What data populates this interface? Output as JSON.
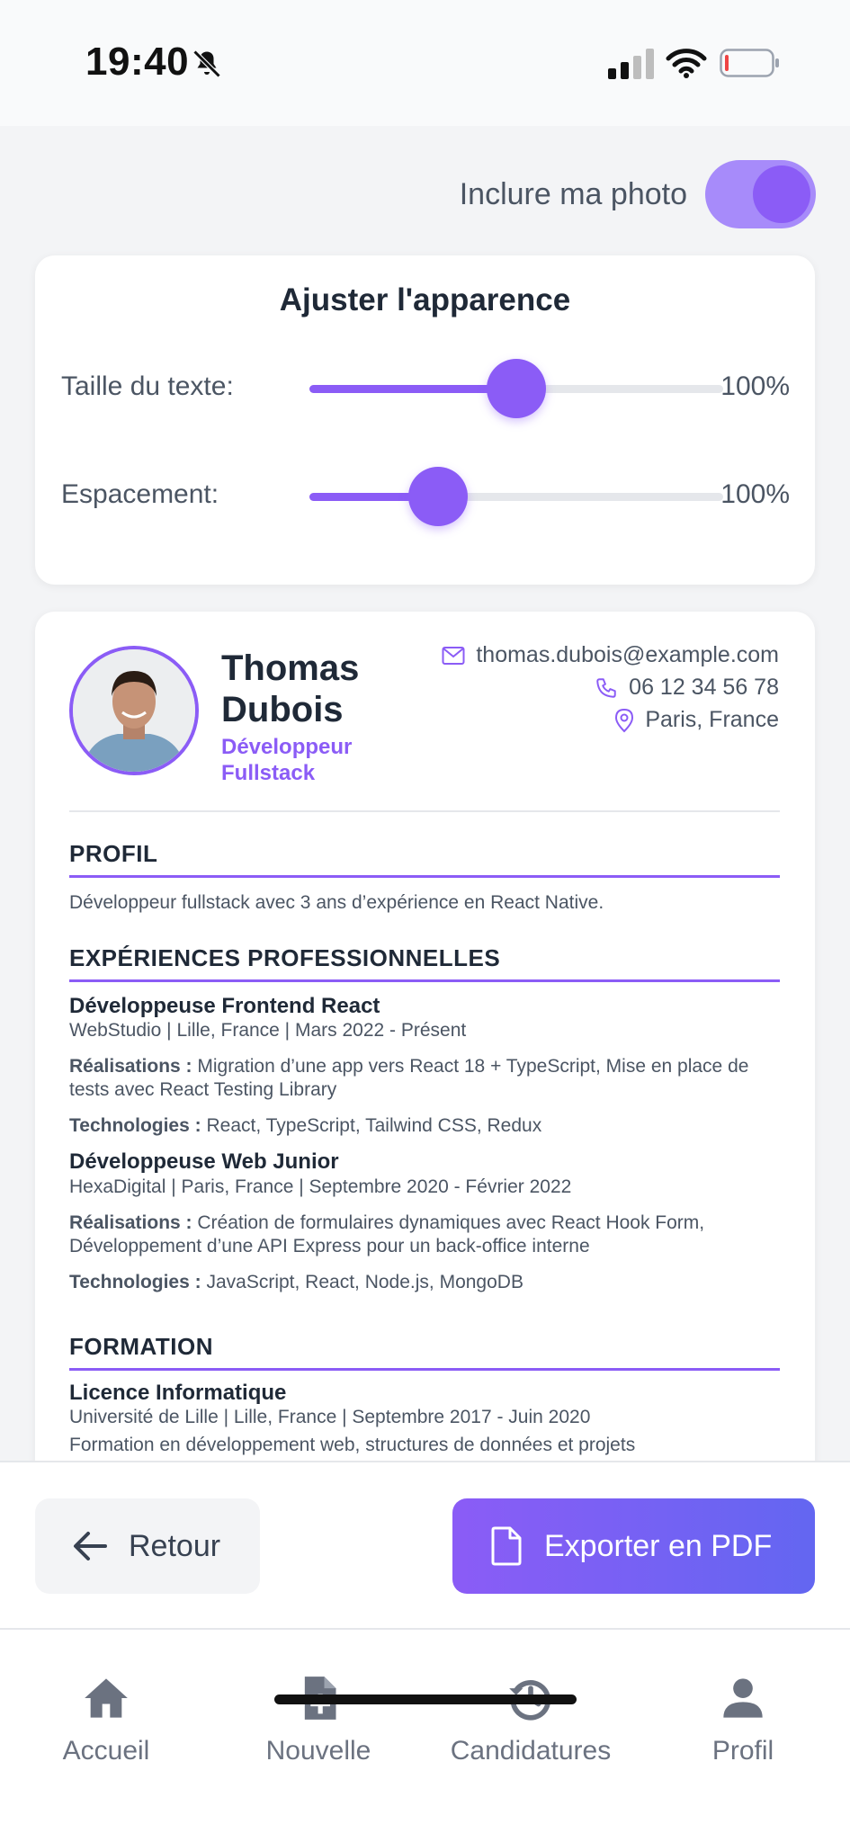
{
  "status_bar": {
    "time": "19:40"
  },
  "photo_toggle": {
    "label": "Inclure ma photo",
    "enabled": true
  },
  "appearance": {
    "title": "Ajuster l'apparence",
    "sliders": [
      {
        "label": "Taille du texte:",
        "value_text": "100%",
        "position": 0.5
      },
      {
        "label": "Espacement:",
        "value_text": "100%",
        "position": 0.31
      }
    ]
  },
  "cv": {
    "name": "Thomas Dubois",
    "role": "Développeur Fullstack",
    "email": "thomas.dubois@example.com",
    "phone": "06 12 34 56 78",
    "location": "Paris, France",
    "profile": {
      "title": "PROFIL",
      "text": "Développeur fullstack avec 3 ans d’expérience en React Native."
    },
    "experience": {
      "title": "EXPÉRIENCES PROFESSIONNELLES",
      "jobs": [
        {
          "title": "Développeuse Frontend React",
          "meta": "WebStudio | Lille, France | Mars 2022 - Présent",
          "achievements_label": "Réalisations :",
          "achievements": "Migration d’une app vers React 18 + TypeScript, Mise en place de tests avec React Testing Library",
          "tech_label": "Technologies :",
          "tech": "React, TypeScript, Tailwind CSS, Redux"
        },
        {
          "title": "Développeuse Web Junior",
          "meta": "HexaDigital | Paris, France | Septembre 2020 - Février 2022",
          "achievements_label": "Réalisations :",
          "achievements": "Création de formulaires dynamiques avec React Hook Form, Développement d’une API Express pour un back-office interne",
          "tech_label": "Technologies :",
          "tech": "JavaScript, React, Node.js, MongoDB"
        }
      ]
    },
    "education": {
      "title": "FORMATION",
      "items": [
        {
          "title": "Licence Informatique",
          "meta": "Université de Lille | Lille, France | Septembre 2017 - Juin 2020",
          "description": "Formation en développement web, structures de données et projets"
        }
      ]
    }
  },
  "actions": {
    "back_label": "Retour",
    "export_label": "Exporter en PDF"
  },
  "tabs": [
    {
      "label": "Accueil",
      "icon": "home-icon"
    },
    {
      "label": "Nouvelle",
      "icon": "document-add-icon"
    },
    {
      "label": "Candidatures",
      "icon": "history-icon"
    },
    {
      "label": "Profil",
      "icon": "user-icon"
    }
  ],
  "colors": {
    "accent": "#8b5cf6",
    "accent_light": "#a78bfa",
    "gradient_end": "#6366f1"
  }
}
